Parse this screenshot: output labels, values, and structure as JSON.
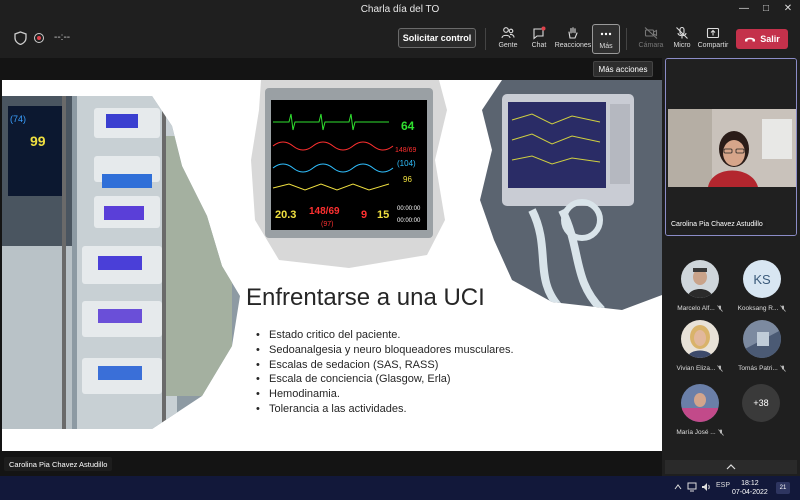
{
  "window": {
    "title": "Charla día del TO"
  },
  "toolbar": {
    "timer": "--:--",
    "request_control_label": "Solicitar control",
    "buttons": {
      "people": "Gente",
      "chat": "Chat",
      "reactions": "Reacciones",
      "more": "Más",
      "camera": "Cámara",
      "mic": "Micro",
      "share": "Compartir"
    },
    "leave_label": "Salir"
  },
  "tooltip": "Más acciones",
  "slide": {
    "title": "Enfrentarse a una UCI",
    "bullets": [
      "Estado critico del paciente.",
      "Sedoanalgesia y neuro bloqueadores musculares.",
      "Escalas de sedacion (SAS, RASS)",
      "Escala de conciencia (Glasgow, Erla)",
      "Hemodinamia.",
      "Tolerancia a las actividades."
    ],
    "monitor_readings": {
      "left_top": "(74)",
      "left_big": "99",
      "mid_hr": "64",
      "mid_bp": "148/69",
      "mid_map": "(104)",
      "mid_spo2": "96",
      "mid_bottom_1": "20.3",
      "mid_bottom_2": "148/69",
      "mid_bottom_3": "(97)",
      "mid_bottom_4": "9",
      "mid_bottom_5": "15",
      "mid_time_1": "00:00:00",
      "mid_time_2": "00:00:00"
    }
  },
  "presenter_name": "Carolina Pia Chavez Astudillo",
  "self_video_name": "Carolina Pia Chavez Astudillo",
  "participants": [
    {
      "name": "Marcelo Alf...",
      "initials": ""
    },
    {
      "name": "Kooksang R...",
      "initials": "KS"
    },
    {
      "name": "Vivian Eliza...",
      "initials": ""
    },
    {
      "name": "Tomás Patri...",
      "initials": ""
    },
    {
      "name": "María José ...",
      "initials": ""
    }
  ],
  "more_participants": "+38",
  "taskbar": {
    "language": "ESP",
    "time": "18:12",
    "date": "07-04-2022",
    "notifications": "21"
  },
  "colors": {
    "leave": "#c4314b",
    "accent": "#8b8cc7",
    "taskbar": "#12183a"
  }
}
